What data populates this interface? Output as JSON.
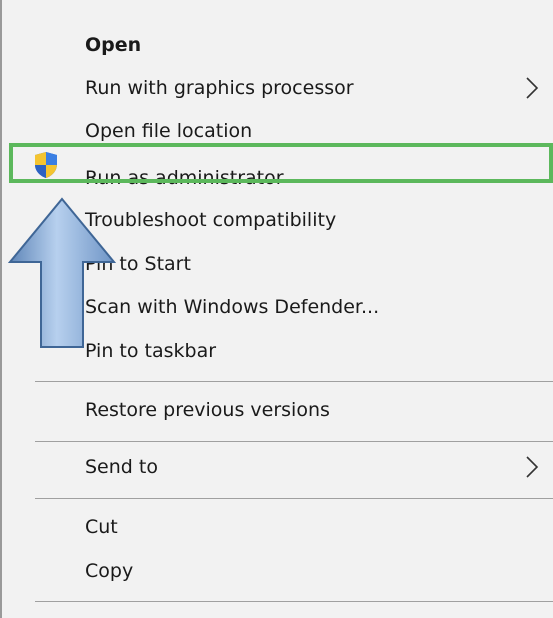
{
  "menu": {
    "items": [
      {
        "label": "Open",
        "bold": true
      },
      {
        "label": "Run with graphics processor",
        "has_submenu": true
      },
      {
        "label": "Open file location"
      },
      {
        "label": "Run as administrator",
        "icon": "shield-icon",
        "highlighted": true
      },
      {
        "label": "Troubleshoot compatibility"
      },
      {
        "label": "Pin to Start"
      },
      {
        "label": "Scan with Windows Defender..."
      },
      {
        "label": "Pin to taskbar"
      },
      {
        "label": "Restore previous versions"
      },
      {
        "label": "Send to",
        "has_submenu": true
      },
      {
        "label": "Cut"
      },
      {
        "label": "Copy"
      }
    ]
  },
  "colors": {
    "menu_background": "#f2f2f2",
    "highlight_border": "#5cb85c",
    "arrow_fill": "#8fb4dc",
    "shield_blue": "#2f6fd6",
    "shield_yellow": "#f4c430"
  }
}
